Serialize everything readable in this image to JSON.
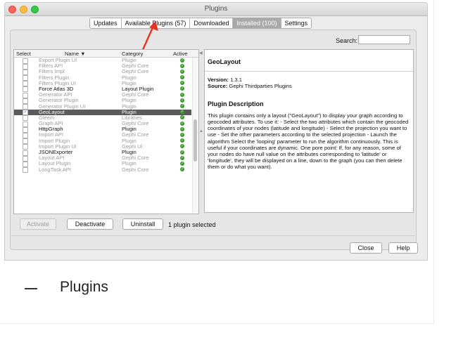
{
  "window": {
    "title": "Plugins"
  },
  "tabs": [
    "Updates",
    "Available Plugins (57)",
    "Downloaded",
    "Installed (100)",
    "Settings"
  ],
  "active_tab": "Installed (100)",
  "search": {
    "label": "Search:",
    "value": ""
  },
  "list": {
    "headers": {
      "select": "Select",
      "name": "Name ▼",
      "category": "Category",
      "active": "Active"
    },
    "rows": [
      {
        "name": "Export Plugin UI",
        "category": "Plugin",
        "checked": false,
        "core": false
      },
      {
        "name": "Filters API",
        "category": "Gephi Core",
        "checked": false,
        "core": false
      },
      {
        "name": "Filters Impl",
        "category": "Gephi Core",
        "checked": false,
        "core": false
      },
      {
        "name": "Filters Plugin",
        "category": "Plugin",
        "checked": false,
        "core": false
      },
      {
        "name": "Filters Plugin UI",
        "category": "Plugin",
        "checked": false,
        "core": false
      },
      {
        "name": "Force Atlas 3D",
        "category": "Layout Plugin",
        "checked": false,
        "core": true
      },
      {
        "name": "Generator API",
        "category": "Gephi Core",
        "checked": false,
        "core": false
      },
      {
        "name": "Generator Plugin",
        "category": "Plugin",
        "checked": false,
        "core": false
      },
      {
        "name": "Generator Plugin UI",
        "category": "Plugin",
        "checked": false,
        "core": false
      },
      {
        "name": "GeoLayout",
        "category": "Plugin",
        "checked": true,
        "core": true,
        "selected": true
      },
      {
        "name": "Gleem",
        "category": "Libraries",
        "checked": false,
        "core": false
      },
      {
        "name": "Graph API",
        "category": "Gephi Core",
        "checked": false,
        "core": false
      },
      {
        "name": "HttpGraph",
        "category": "Plugin",
        "checked": false,
        "core": true
      },
      {
        "name": "Import API",
        "category": "Gephi Core",
        "checked": false,
        "core": false
      },
      {
        "name": "Import Plugin",
        "category": "Plugin",
        "checked": false,
        "core": false
      },
      {
        "name": "Import Plugin UI",
        "category": "Gephi UI",
        "checked": false,
        "core": false
      },
      {
        "name": "JSONExporter",
        "category": "Plugin",
        "checked": false,
        "core": true
      },
      {
        "name": "Layout API",
        "category": "Gephi Core",
        "checked": false,
        "core": false
      },
      {
        "name": "Layout Plugin",
        "category": "Plugin",
        "checked": false,
        "core": false
      },
      {
        "name": "LongTask API",
        "category": "Gephi Core",
        "checked": false,
        "core": false
      }
    ]
  },
  "detail": {
    "title": "GeoLayout",
    "version_label": "Version:",
    "version": "1.3.1",
    "source_label": "Source:",
    "source": "Gephi Thirdparties Plugins",
    "desc_heading": "Plugin Description",
    "description": "This plugin contains only a layout (\"GeoLayout\") to display your graph according to geocoded attributes. To use it: - Select the two attributes which contain the geocoded coordinates of your nodes (latitude and longitude) - Select the projection you want to use - Set the other parameters according to the selected projection - Launch the algorithm Select the 'looping' parameter to run the algorithm continuously. This is useful if your coordinates are dynamic. One pore point: If, for any reason, some of your nodes do have null value on the attributes corresponding to 'latitude' or 'longitude', they will be displayed on a line, down to the graph (you can then delete them or do what you want)."
  },
  "buttons": {
    "activate": "Activate",
    "deactivate": "Deactivate",
    "uninstall": "Uninstall",
    "close": "Close",
    "help": "Help"
  },
  "status": "1 plugin selected",
  "caption": {
    "text": "Plugins"
  },
  "colors": {
    "arrow": "#e8321d",
    "selected_row": "#5b5b5b",
    "active_tab": "#a9a9a9",
    "ok": "#3c9a2e"
  }
}
